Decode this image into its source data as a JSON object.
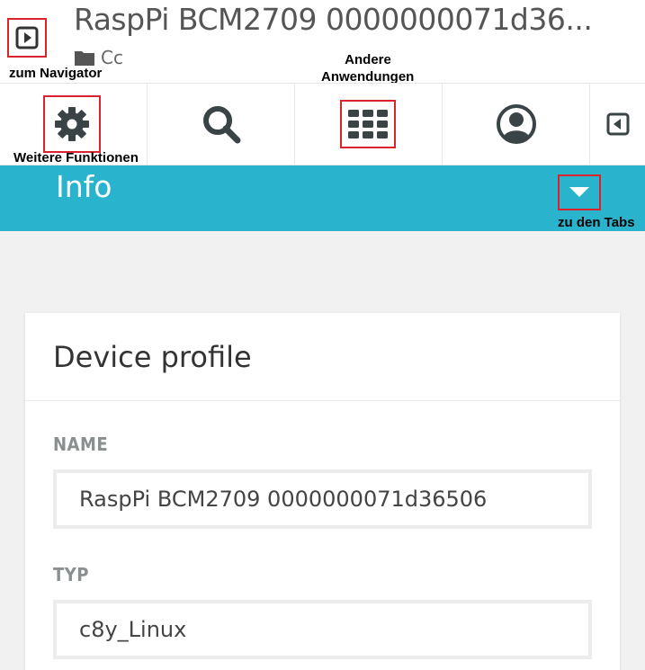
{
  "header": {
    "title": "RaspPi BCM2709 0000000071d36...",
    "breadcrumb": {
      "label": "Cc",
      "icon": "folder-icon"
    },
    "nav_toggle_icon": "play-square-icon"
  },
  "annotations": {
    "navigator": "zum Navigator",
    "other_apps_line1": "Andere",
    "other_apps_line2": "Anwendungen",
    "more_functions": "Weitere Funktionen",
    "tabs": "zu den Tabs"
  },
  "toolbar": {
    "items": [
      {
        "icon": "gear-icon"
      },
      {
        "icon": "search-icon"
      },
      {
        "icon": "app-grid-icon"
      },
      {
        "icon": "user-icon"
      },
      {
        "icon": "collapse-left-icon"
      }
    ]
  },
  "infobar": {
    "title": "Info",
    "tabs_toggle_icon": "caret-down-icon"
  },
  "device_profile": {
    "title": "Device profile",
    "name_label": "NAME",
    "name_value": "RaspPi BCM2709 0000000071d36506",
    "type_label": "TYP",
    "type_value": "c8y_Linux"
  },
  "colors": {
    "accent": "#29b3cc",
    "annotation_border": "#d9232d",
    "icon_dark": "#3a4346"
  }
}
